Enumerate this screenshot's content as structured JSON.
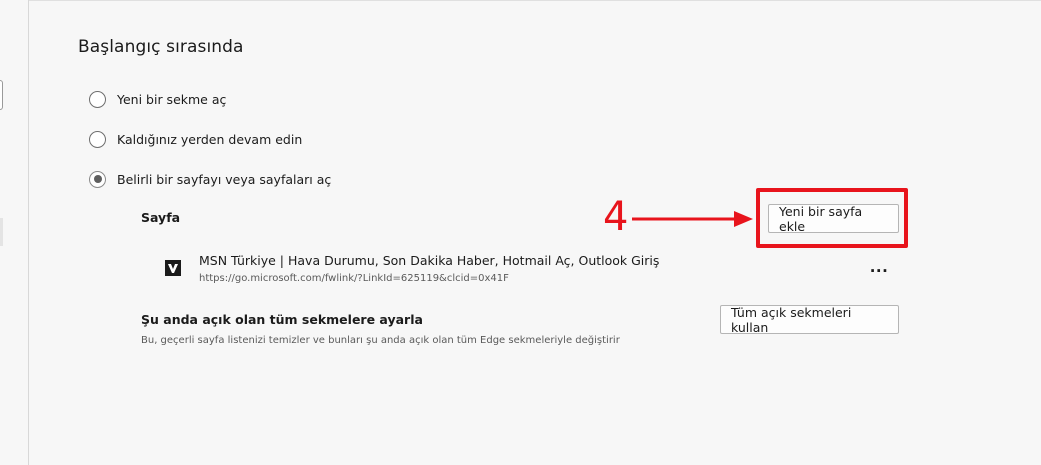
{
  "section": {
    "title": "Başlangıç sırasında"
  },
  "startup_options": [
    {
      "label": "Yeni bir sekme aç",
      "checked": false
    },
    {
      "label": "Kaldığınız yerden devam edin",
      "checked": false
    },
    {
      "label": "Belirli bir sayfayı veya sayfaları aç",
      "checked": true
    }
  ],
  "pages": {
    "heading": "Sayfa",
    "add_button_label": "Yeni bir sayfa ekle",
    "items": [
      {
        "title": "MSN Türkiye | Hava Durumu, Son Dakika Haber, Hotmail Aç, Outlook Giriş",
        "url": "https://go.microsoft.com/fwlink/?LinkId=625119&clcid=0x41F",
        "more_label": "..."
      }
    ]
  },
  "use_open_tabs": {
    "title": "Şu anda açık olan tüm sekmelere ayarla",
    "description": "Bu, geçerli sayfa listenizi temizler ve bunları şu anda açık olan tüm Edge sekmeleriyle değiştirir",
    "button_label": "Tüm açık sekmeleri kullan"
  },
  "annotation": {
    "step_number": "4",
    "color": "#e8141c"
  },
  "colors": {
    "background": "#f7f7f7",
    "text": "#1b1b1b",
    "secondary_text": "#5a5a5a",
    "annotation_red": "#e8141c"
  },
  "icons": {
    "page_favicon": "msn-favicon-icon",
    "more": "more-options-icon"
  }
}
